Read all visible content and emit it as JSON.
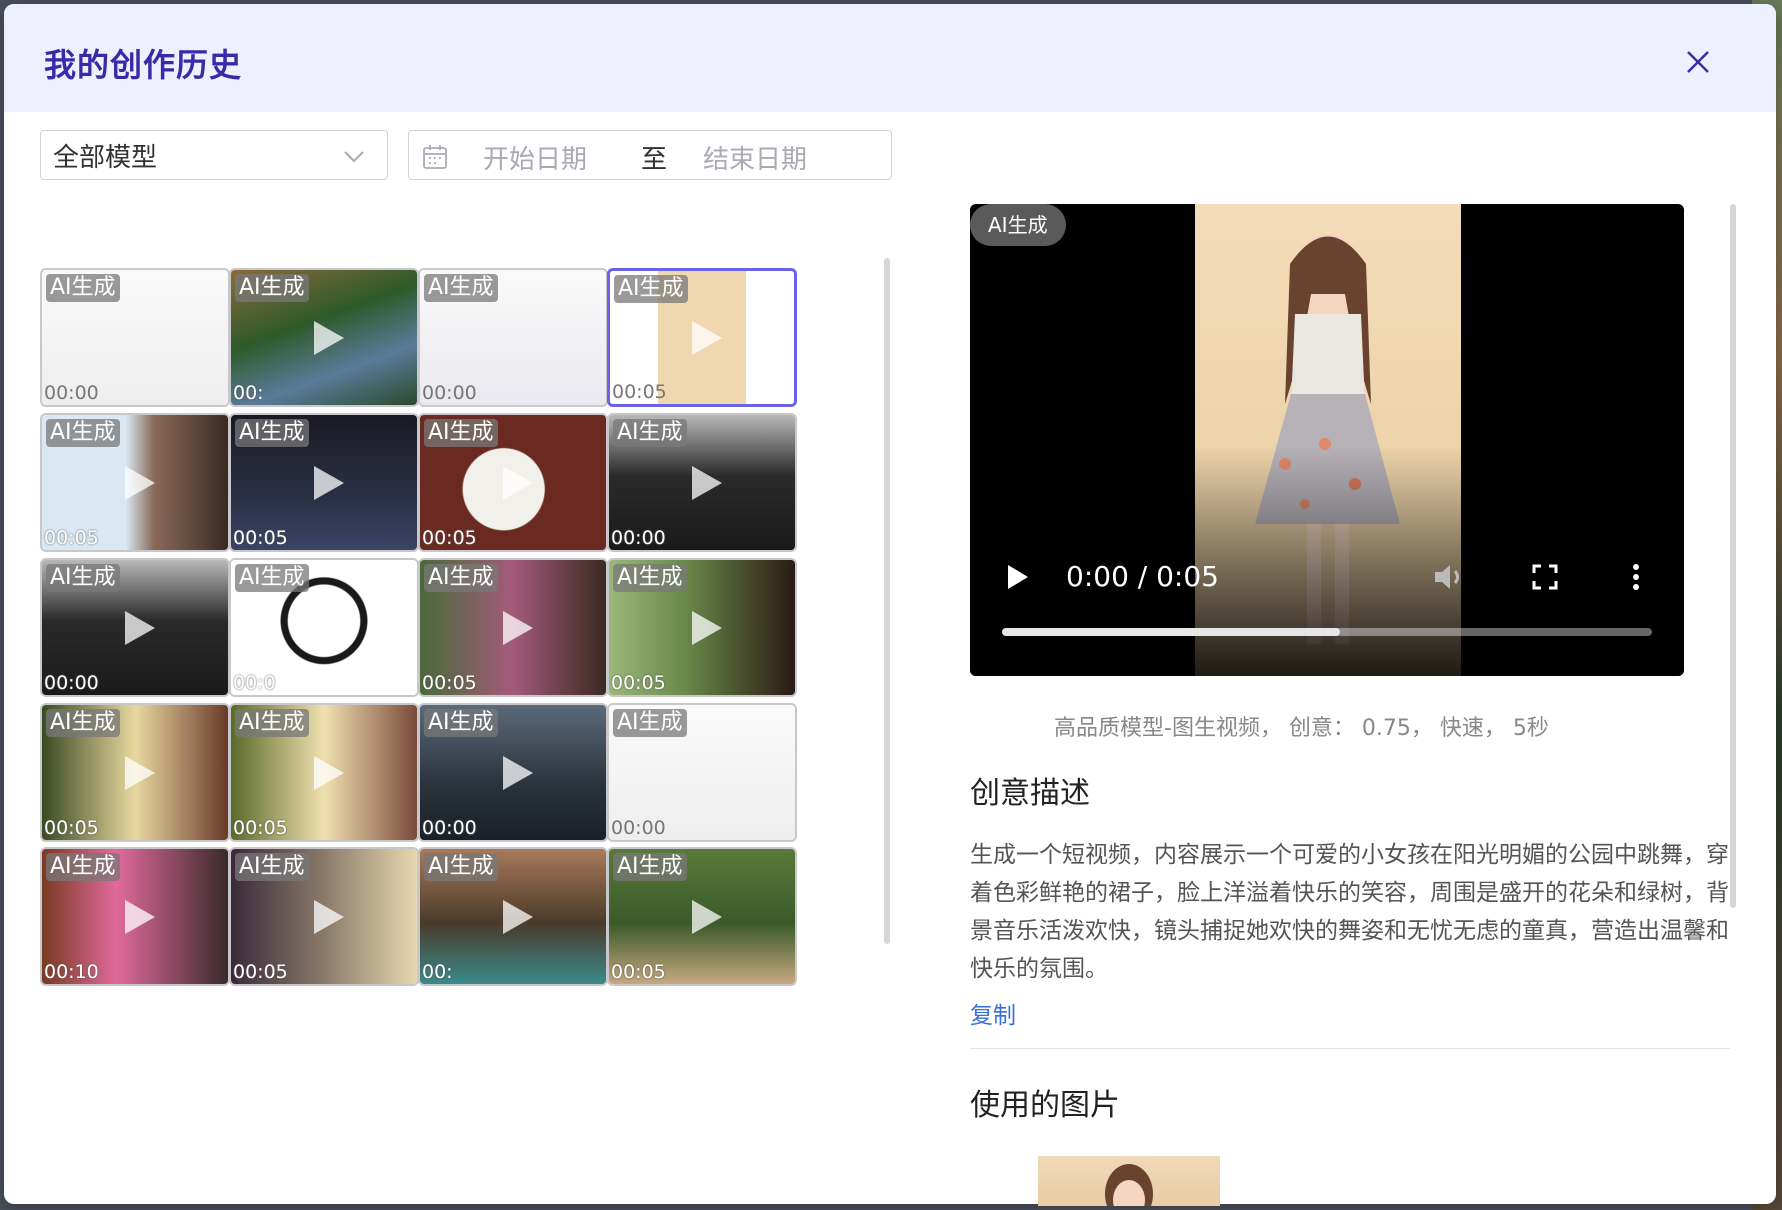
{
  "dialog": {
    "title": "我的创作历史"
  },
  "filters": {
    "model_select": "全部模型",
    "start_placeholder": "开始日期",
    "separator": "至",
    "end_placeholder": "结束日期"
  },
  "grid": {
    "tag": "AI生成",
    "items": [
      {
        "duration": "00:00",
        "style": "doc"
      },
      {
        "duration": "00:",
        "style": "garden"
      },
      {
        "duration": "00:00",
        "style": "doc2"
      },
      {
        "duration": "00:05",
        "style": "girl",
        "selected": true
      },
      {
        "duration": "00:05",
        "style": "drink"
      },
      {
        "duration": "00:05",
        "style": "bed"
      },
      {
        "duration": "00:05",
        "style": "food"
      },
      {
        "duration": "00:00",
        "style": "crowd"
      },
      {
        "duration": "00:00",
        "style": "crowd2"
      },
      {
        "duration": "00:0",
        "style": "panda"
      },
      {
        "duration": "00:05",
        "style": "flower"
      },
      {
        "duration": "00:05",
        "style": "drink2"
      },
      {
        "duration": "00:05",
        "style": "sunset"
      },
      {
        "duration": "00:05",
        "style": "sunset2"
      },
      {
        "duration": "00:00",
        "style": "house"
      },
      {
        "duration": "00:00",
        "style": "doc3"
      },
      {
        "duration": "00:10",
        "style": "balloon"
      },
      {
        "duration": "00:05",
        "style": "hands"
      },
      {
        "duration": "00:",
        "style": "bowl"
      },
      {
        "duration": "00:05",
        "style": "path"
      }
    ]
  },
  "preview": {
    "badge": "AI生成",
    "time": "0:00 / 0:05",
    "progress": 0.52
  },
  "meta": "高品质模型-图生视频， 创意： 0.75， 快速， 5秒",
  "description": {
    "title": "创意描述",
    "text": "生成一个短视频，内容展示一个可爱的小女孩在阳光明媚的公园中跳舞，穿着色彩鲜艳的裙子，脸上洋溢着快乐的笑容，周围是盛开的花朵和绿树，背景音乐活泼欢快，镜头捕捉她欢快的舞姿和无忧无虑的童真，营造出温馨和快乐的氛围。",
    "copy_label": "复制"
  },
  "images_section": {
    "title": "使用的图片"
  }
}
